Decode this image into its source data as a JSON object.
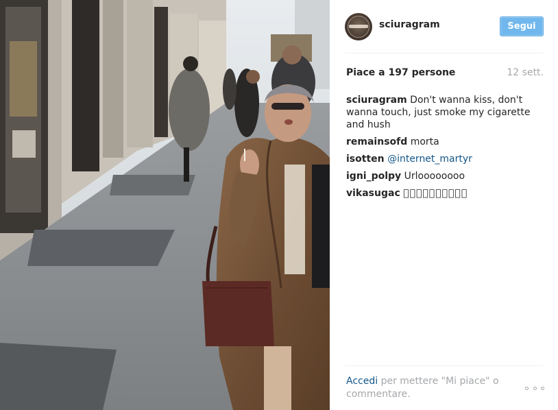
{
  "post": {
    "photo_alt": "Street photo of an elderly woman in a fur coat holding a cigarette",
    "header": {
      "username": "sciuragram",
      "follow_label": "Segui"
    },
    "stats": {
      "likes_text": "Piace a 197 persone",
      "time_text": "12 sett."
    },
    "comments": [
      {
        "user": "sciuragram",
        "text": "Don't wanna kiss, don't wanna touch, just smoke my cigarette and hush"
      },
      {
        "user": "remainsofd",
        "text": "morta"
      },
      {
        "user": "isotten",
        "mention": "@internet_martyr"
      },
      {
        "user": "igni_polpy",
        "text": "Urloooooooo"
      },
      {
        "user": "vikasugac",
        "text": "􀀀􀀀􀀀􀀀􀀀􀀀􀀀􀀀􀀀􀀀"
      }
    ],
    "footer": {
      "login_text": "Accedi",
      "prompt_rest": " per mettere \"Mi piace\" o commentare."
    },
    "colors": {
      "follow_bg": "#70b7ed",
      "link": "#125688",
      "muted": "#a5a7aa"
    },
    "icons": {
      "more": "more-options-icon"
    }
  }
}
